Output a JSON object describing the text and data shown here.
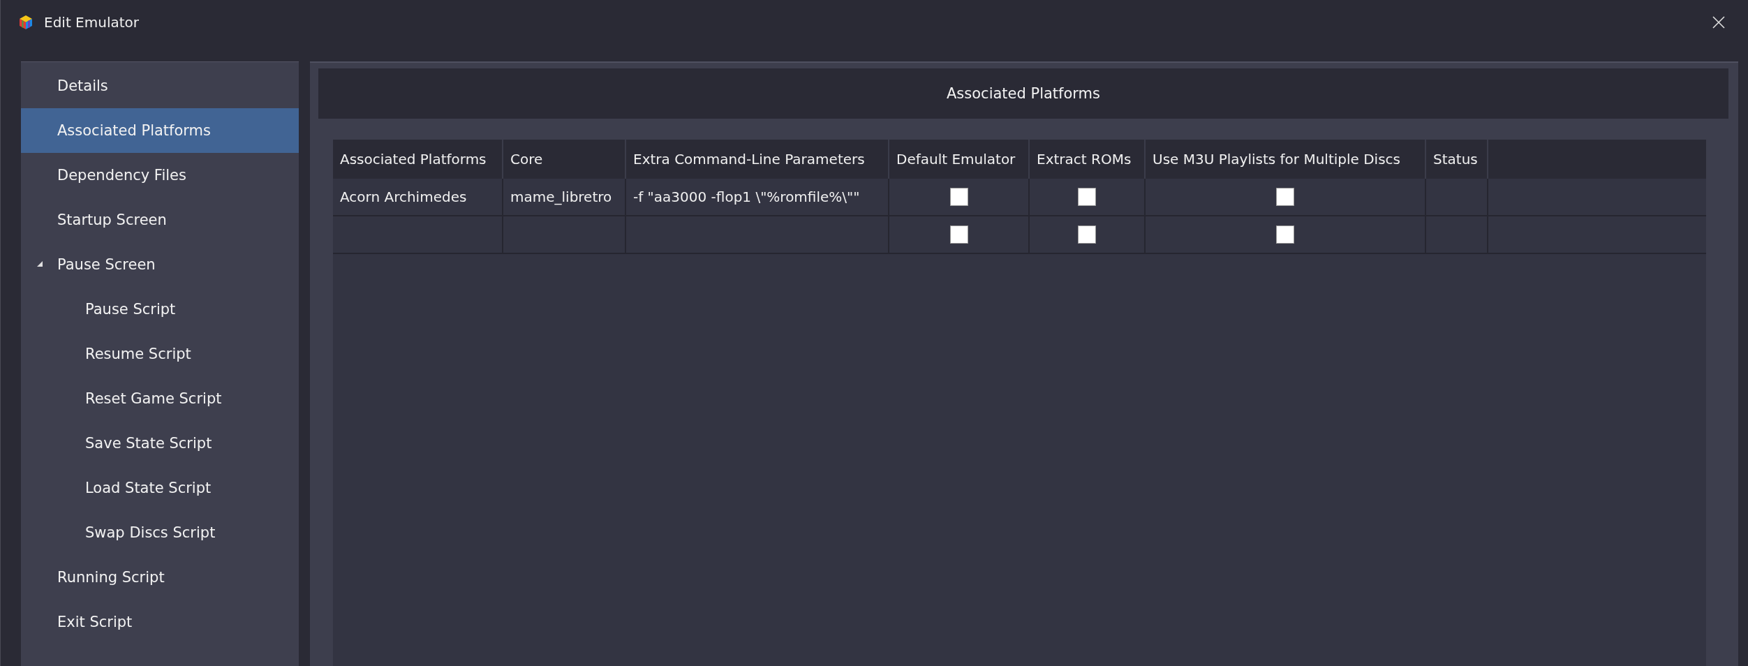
{
  "window": {
    "title": "Edit Emulator"
  },
  "sidebar": {
    "items": [
      {
        "label": "Details",
        "selected": false
      },
      {
        "label": "Associated Platforms",
        "selected": true
      },
      {
        "label": "Dependency Files",
        "selected": false
      },
      {
        "label": "Startup Screen",
        "selected": false
      },
      {
        "label": "Pause Screen",
        "selected": false,
        "expanded": true,
        "children": [
          {
            "label": "Pause Script",
            "selected": false
          },
          {
            "label": "Resume Script",
            "selected": false
          },
          {
            "label": "Reset Game Script",
            "selected": false
          },
          {
            "label": "Save State Script",
            "selected": false
          },
          {
            "label": "Load State Script",
            "selected": false
          },
          {
            "label": "Swap Discs Script",
            "selected": false
          }
        ]
      },
      {
        "label": "Running Script",
        "selected": false
      },
      {
        "label": "Exit Script",
        "selected": false
      }
    ]
  },
  "panel": {
    "title": "Associated Platforms"
  },
  "table": {
    "columns": [
      "Associated Platforms",
      "Core",
      "Extra Command-Line Parameters",
      "Default Emulator",
      "Extract ROMs",
      "Use M3U Playlists for Multiple Discs",
      "Status"
    ],
    "rows": [
      {
        "cells": [
          {
            "kind": "text",
            "text": "Acorn Archimedes"
          },
          {
            "kind": "text",
            "text": "mame_libretro"
          },
          {
            "kind": "text",
            "text": "-f \"aa3000 -flop1 \\\"%romfile%\\\"\""
          },
          {
            "kind": "checkbox",
            "checked": false
          },
          {
            "kind": "checkbox",
            "checked": false
          },
          {
            "kind": "checkbox",
            "checked": false
          },
          {
            "kind": "empty"
          }
        ]
      },
      {
        "cells": [
          {
            "kind": "empty"
          },
          {
            "kind": "empty"
          },
          {
            "kind": "empty"
          },
          {
            "kind": "checkbox",
            "checked": false
          },
          {
            "kind": "checkbox",
            "checked": false
          },
          {
            "kind": "checkbox",
            "checked": false
          },
          {
            "kind": "empty"
          }
        ]
      }
    ]
  }
}
